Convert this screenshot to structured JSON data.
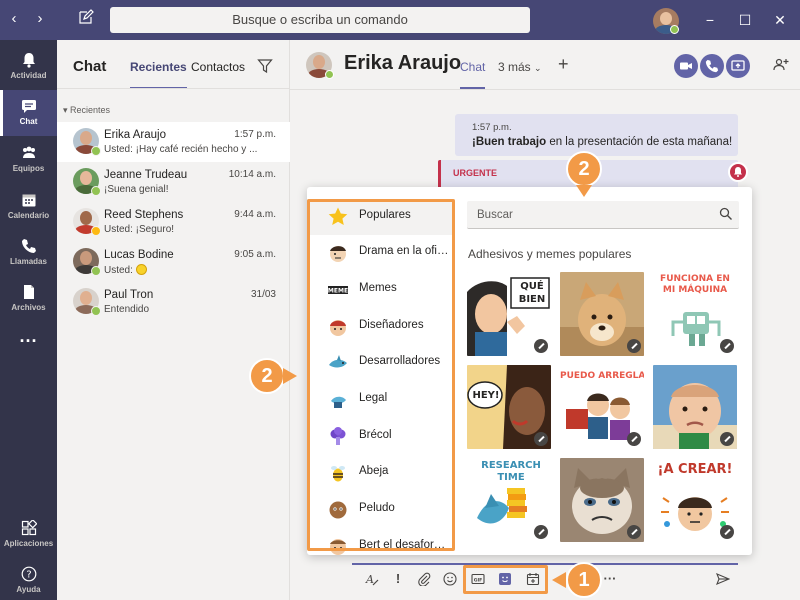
{
  "titlebar": {
    "search_placeholder": "Busque o escriba un comando",
    "back_icon": "‹",
    "forward_icon": "›",
    "minimize_icon": "−",
    "maximize_icon": "☐",
    "close_icon": "✕"
  },
  "appbar": {
    "items": [
      {
        "label": "Actividad",
        "icon": "bell-icon"
      },
      {
        "label": "Chat",
        "icon": "chat-icon"
      },
      {
        "label": "Equipos",
        "icon": "teams-icon"
      },
      {
        "label": "Calendario",
        "icon": "calendar-icon"
      },
      {
        "label": "Llamadas",
        "icon": "phone-icon"
      },
      {
        "label": "Archivos",
        "icon": "files-icon"
      }
    ],
    "more": "···",
    "bottom": [
      {
        "label": "Aplicaciones",
        "icon": "apps-icon"
      },
      {
        "label": "Ayuda",
        "icon": "help-icon"
      }
    ]
  },
  "chatlist": {
    "title": "Chat",
    "tabs": [
      "Recientes",
      "Contactos"
    ],
    "section": "Recientes",
    "chats": [
      {
        "name": "Erika Araujo",
        "time": "1:57 p.m.",
        "preview": "Usted: ¡Hay café recién hecho y ...",
        "status": "available"
      },
      {
        "name": "Jeanne Trudeau",
        "time": "10:14 a.m.",
        "preview": "¡Suena genial!",
        "status": "available"
      },
      {
        "name": "Reed Stephens",
        "time": "9:44 a.m.",
        "preview": "Usted: ¡Seguro!",
        "status": "away"
      },
      {
        "name": "Lucas Bodine",
        "time": "9:05 a.m.",
        "preview": "Usted: ",
        "status": "available"
      },
      {
        "name": "Paul Tron",
        "time": "31/03",
        "preview": "Entendido",
        "status": "available"
      }
    ]
  },
  "header": {
    "name": "Erika Araujo",
    "tabs": [
      "Chat",
      "3 más"
    ],
    "plus": "+"
  },
  "conversation": {
    "message": {
      "time": "1:57 p.m.",
      "bold": "¡Buen trabajo",
      "rest": " en la presentación de esta mañana!"
    },
    "urgent_label": "URGENTE"
  },
  "sticker_panel": {
    "categories": [
      "Populares",
      "Drama en la oficina",
      "Memes",
      "Diseñadores",
      "Desarrolladores",
      "Legal",
      "Brécol",
      "Abeja",
      "Peludo",
      "Bert el desaforado"
    ],
    "search_placeholder": "Buscar",
    "heading": "Adhesivos y memes populares",
    "stickers": [
      {
        "name": "que-bien-sticker",
        "text": "QUÉ BIEN"
      },
      {
        "name": "doge-sticker",
        "text": ""
      },
      {
        "name": "funciona-sticker",
        "text": "FUNCIONA EN MI MÁQUINA"
      },
      {
        "name": "hey-sticker",
        "text": "HEY!"
      },
      {
        "name": "puedo-arreglarlo-sticker",
        "text": "PUEDO ARREGLARLO"
      },
      {
        "name": "success-kid-sticker",
        "text": ""
      },
      {
        "name": "research-time-sticker",
        "text": "RESEARCH TIME"
      },
      {
        "name": "grumpy-cat-sticker",
        "text": ""
      },
      {
        "name": "a-crear-sticker",
        "text": "¡A CREAR!"
      }
    ]
  },
  "callouts": {
    "one": "1",
    "two": "2"
  },
  "colors": {
    "brand": "#6264a7",
    "titlebar": "#464775",
    "appbar": "#33344a",
    "highlight": "#f29a47",
    "urgent": "#c4314b",
    "available": "#92c353",
    "away": "#fdb913"
  }
}
